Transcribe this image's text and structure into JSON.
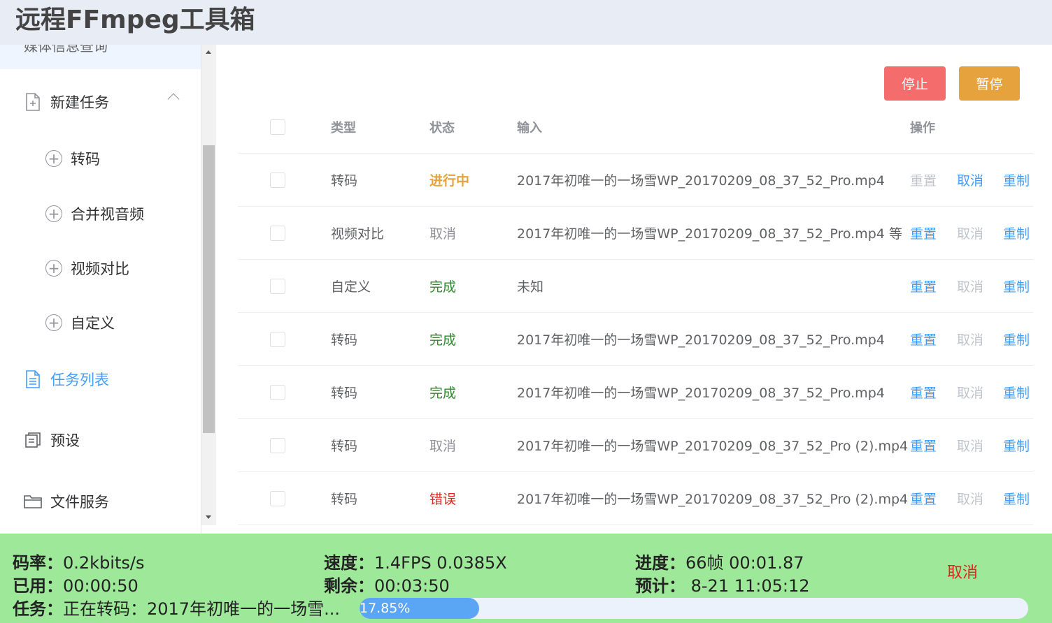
{
  "app": {
    "title": "远程FFmpeg工具箱"
  },
  "sidebar": {
    "top_partial": "媒体信息查询",
    "new_task": "新建任务",
    "subitems": [
      "转码",
      "合并视音频",
      "视频对比",
      "自定义"
    ],
    "task_list": "任务列表",
    "presets": "预设",
    "file_service": "文件服务"
  },
  "toolbar": {
    "stop_label": "停止",
    "pause_label": "暂停"
  },
  "table": {
    "headers": {
      "type": "类型",
      "status": "状态",
      "input": "输入",
      "actions": "操作"
    },
    "rows": [
      {
        "type": "转码",
        "status": "进行中",
        "status_kind": "running",
        "input": "2017年初唯一的一场雪WP_20170209_08_37_52_Pro.mp4",
        "reset": "重置",
        "reset_enabled": false,
        "cancel": "取消",
        "cancel_enabled": true,
        "clone": "重制"
      },
      {
        "type": "视频对比",
        "status": "取消",
        "status_kind": "cancel",
        "input": "2017年初唯一的一场雪WP_20170209_08_37_52_Pro.mp4 等",
        "reset": "重置",
        "reset_enabled": true,
        "cancel": "取消",
        "cancel_enabled": false,
        "clone": "重制"
      },
      {
        "type": "自定义",
        "status": "完成",
        "status_kind": "done",
        "input": "未知",
        "reset": "重置",
        "reset_enabled": true,
        "cancel": "取消",
        "cancel_enabled": false,
        "clone": "重制"
      },
      {
        "type": "转码",
        "status": "完成",
        "status_kind": "done",
        "input": "2017年初唯一的一场雪WP_20170209_08_37_52_Pro.mp4",
        "reset": "重置",
        "reset_enabled": true,
        "cancel": "取消",
        "cancel_enabled": false,
        "clone": "重制"
      },
      {
        "type": "转码",
        "status": "完成",
        "status_kind": "done",
        "input": "2017年初唯一的一场雪WP_20170209_08_37_52_Pro.mp4",
        "reset": "重置",
        "reset_enabled": true,
        "cancel": "取消",
        "cancel_enabled": false,
        "clone": "重制"
      },
      {
        "type": "转码",
        "status": "取消",
        "status_kind": "cancel",
        "input": "2017年初唯一的一场雪WP_20170209_08_37_52_Pro (2).mp4",
        "reset": "重置",
        "reset_enabled": true,
        "cancel": "取消",
        "cancel_enabled": false,
        "clone": "重制"
      },
      {
        "type": "转码",
        "status": "错误",
        "status_kind": "error",
        "input": "2017年初唯一的一场雪WP_20170209_08_37_52_Pro (2).mp4",
        "reset": "重置",
        "reset_enabled": true,
        "cancel": "取消",
        "cancel_enabled": false,
        "clone": "重制"
      }
    ]
  },
  "footer": {
    "bitrate_label": "码率：",
    "bitrate": "0.2kbits/s",
    "speed_label": "速度：",
    "speed": "1.4FPS 0.0385X",
    "progress_label": "进度：",
    "progress": "66帧 00:01.87",
    "used_label": "已用：",
    "used": "00:00:50",
    "remain_label": "剩余：",
    "remain": "00:03:50",
    "eta_label": "预计：",
    "eta": " 8-21 11:05:12",
    "task_label": "任务：",
    "task": "正在转码：2017年初唯一的一场雪...",
    "cancel_label": "取消",
    "percent_text": "17.85%",
    "percent_value": 17.85
  },
  "colors": {
    "accent": "#409eff",
    "stop": "#f56c6c",
    "pause": "#e6a23c",
    "footer_bg": "#9ee89a",
    "running": "#e6a23c",
    "done": "#2e8b2e",
    "error": "#e0251d"
  }
}
